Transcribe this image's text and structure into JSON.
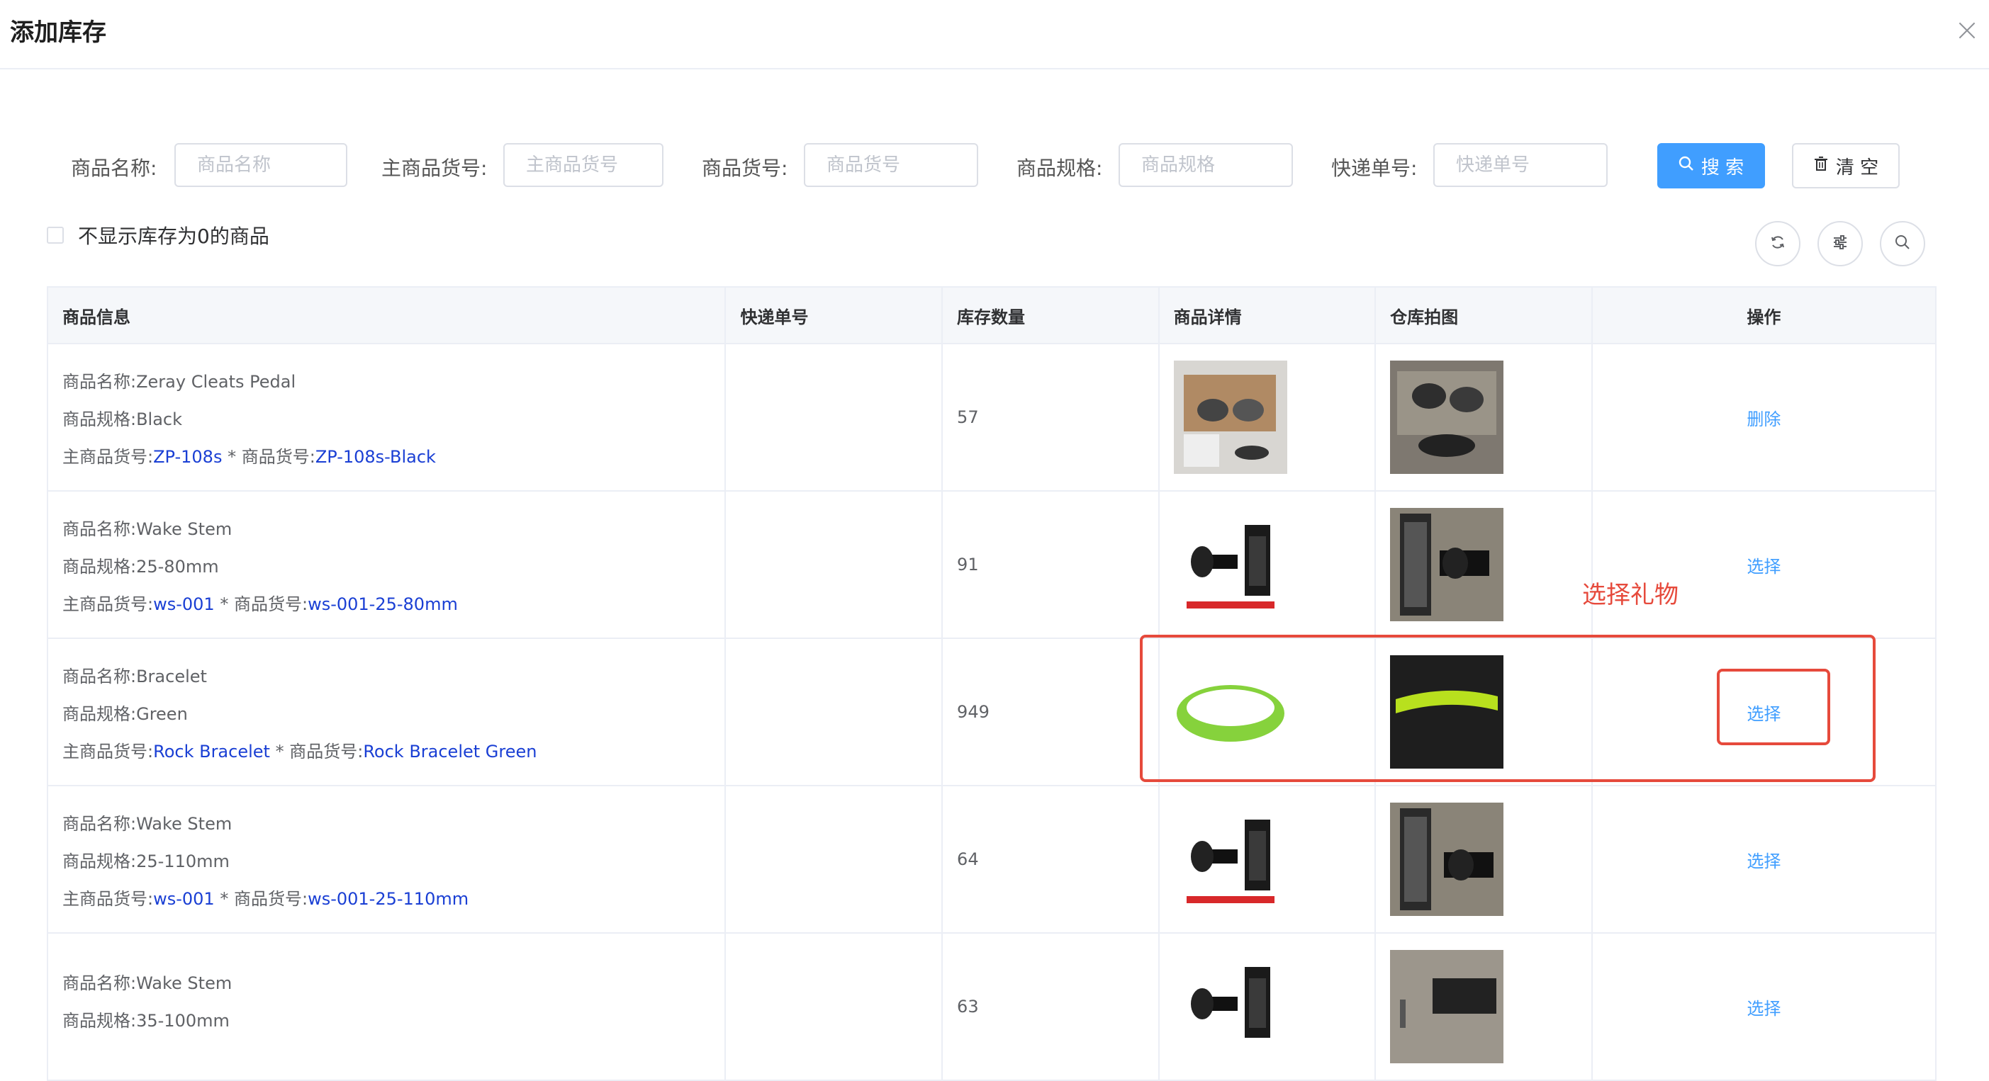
{
  "dialog": {
    "title": "添加库存"
  },
  "filters": [
    {
      "label": "商品名称:",
      "placeholder": "商品名称",
      "value": ""
    },
    {
      "label": "主商品货号:",
      "placeholder": "主商品货号",
      "value": ""
    },
    {
      "label": "商品货号:",
      "placeholder": "商品货号",
      "value": ""
    },
    {
      "label": "商品规格:",
      "placeholder": "商品规格",
      "value": ""
    },
    {
      "label": "快递单号:",
      "placeholder": "快递单号",
      "value": ""
    }
  ],
  "buttons": {
    "search": "搜 索",
    "clear": "清 空"
  },
  "checkbox": {
    "label": "不显示库存为0的商品",
    "checked": false
  },
  "table": {
    "headers": [
      "商品信息",
      "快递单号",
      "库存数量",
      "商品详情",
      "仓库拍图",
      "操作"
    ],
    "rows": [
      {
        "name_label": "商品名称:",
        "name": "Zeray Cleats Pedal",
        "spec_label": "商品规格:",
        "spec": "Black",
        "main_sku_label": "主商品货号:",
        "main_sku": "ZP-108s",
        "sep": " * ",
        "sku_label": "商品货号:",
        "sku": "ZP-108s-Black",
        "tracking": "",
        "stock": "57",
        "action": "删除"
      },
      {
        "name_label": "商品名称:",
        "name": "Wake Stem",
        "spec_label": "商品规格:",
        "spec": "25-80mm",
        "main_sku_label": "主商品货号:",
        "main_sku": "ws-001",
        "sep": " * ",
        "sku_label": "商品货号:",
        "sku": "ws-001-25-80mm",
        "tracking": "",
        "stock": "91",
        "action": "选择"
      },
      {
        "name_label": "商品名称:",
        "name": "Bracelet",
        "spec_label": "商品规格:",
        "spec": "Green",
        "main_sku_label": "主商品货号:",
        "main_sku": "Rock Bracelet",
        "sep": " * ",
        "sku_label": "商品货号:",
        "sku": "Rock Bracelet Green",
        "tracking": "",
        "stock": "949",
        "action": "选择"
      },
      {
        "name_label": "商品名称:",
        "name": "Wake Stem",
        "spec_label": "商品规格:",
        "spec": "25-110mm",
        "main_sku_label": "主商品货号:",
        "main_sku": "ws-001",
        "sep": " * ",
        "sku_label": "商品货号:",
        "sku": "ws-001-25-110mm",
        "tracking": "",
        "stock": "64",
        "action": "选择"
      },
      {
        "name_label": "商品名称:",
        "name": "Wake Stem",
        "spec_label": "商品规格:",
        "spec": "35-100mm",
        "main_sku_label": "",
        "main_sku": "",
        "sep": "",
        "sku_label": "",
        "sku": "",
        "tracking": "",
        "stock": "63",
        "action": "选择"
      }
    ]
  },
  "annotation": {
    "text": "选择礼物"
  },
  "icons": [
    "close-icon",
    "search-icon",
    "trash-icon",
    "refresh-icon",
    "settings-sliders-icon",
    "search-icon"
  ],
  "colors": {
    "primary": "#409eff",
    "link_blue": "#1a3fd4",
    "annotation_red": "#e64a3c"
  }
}
